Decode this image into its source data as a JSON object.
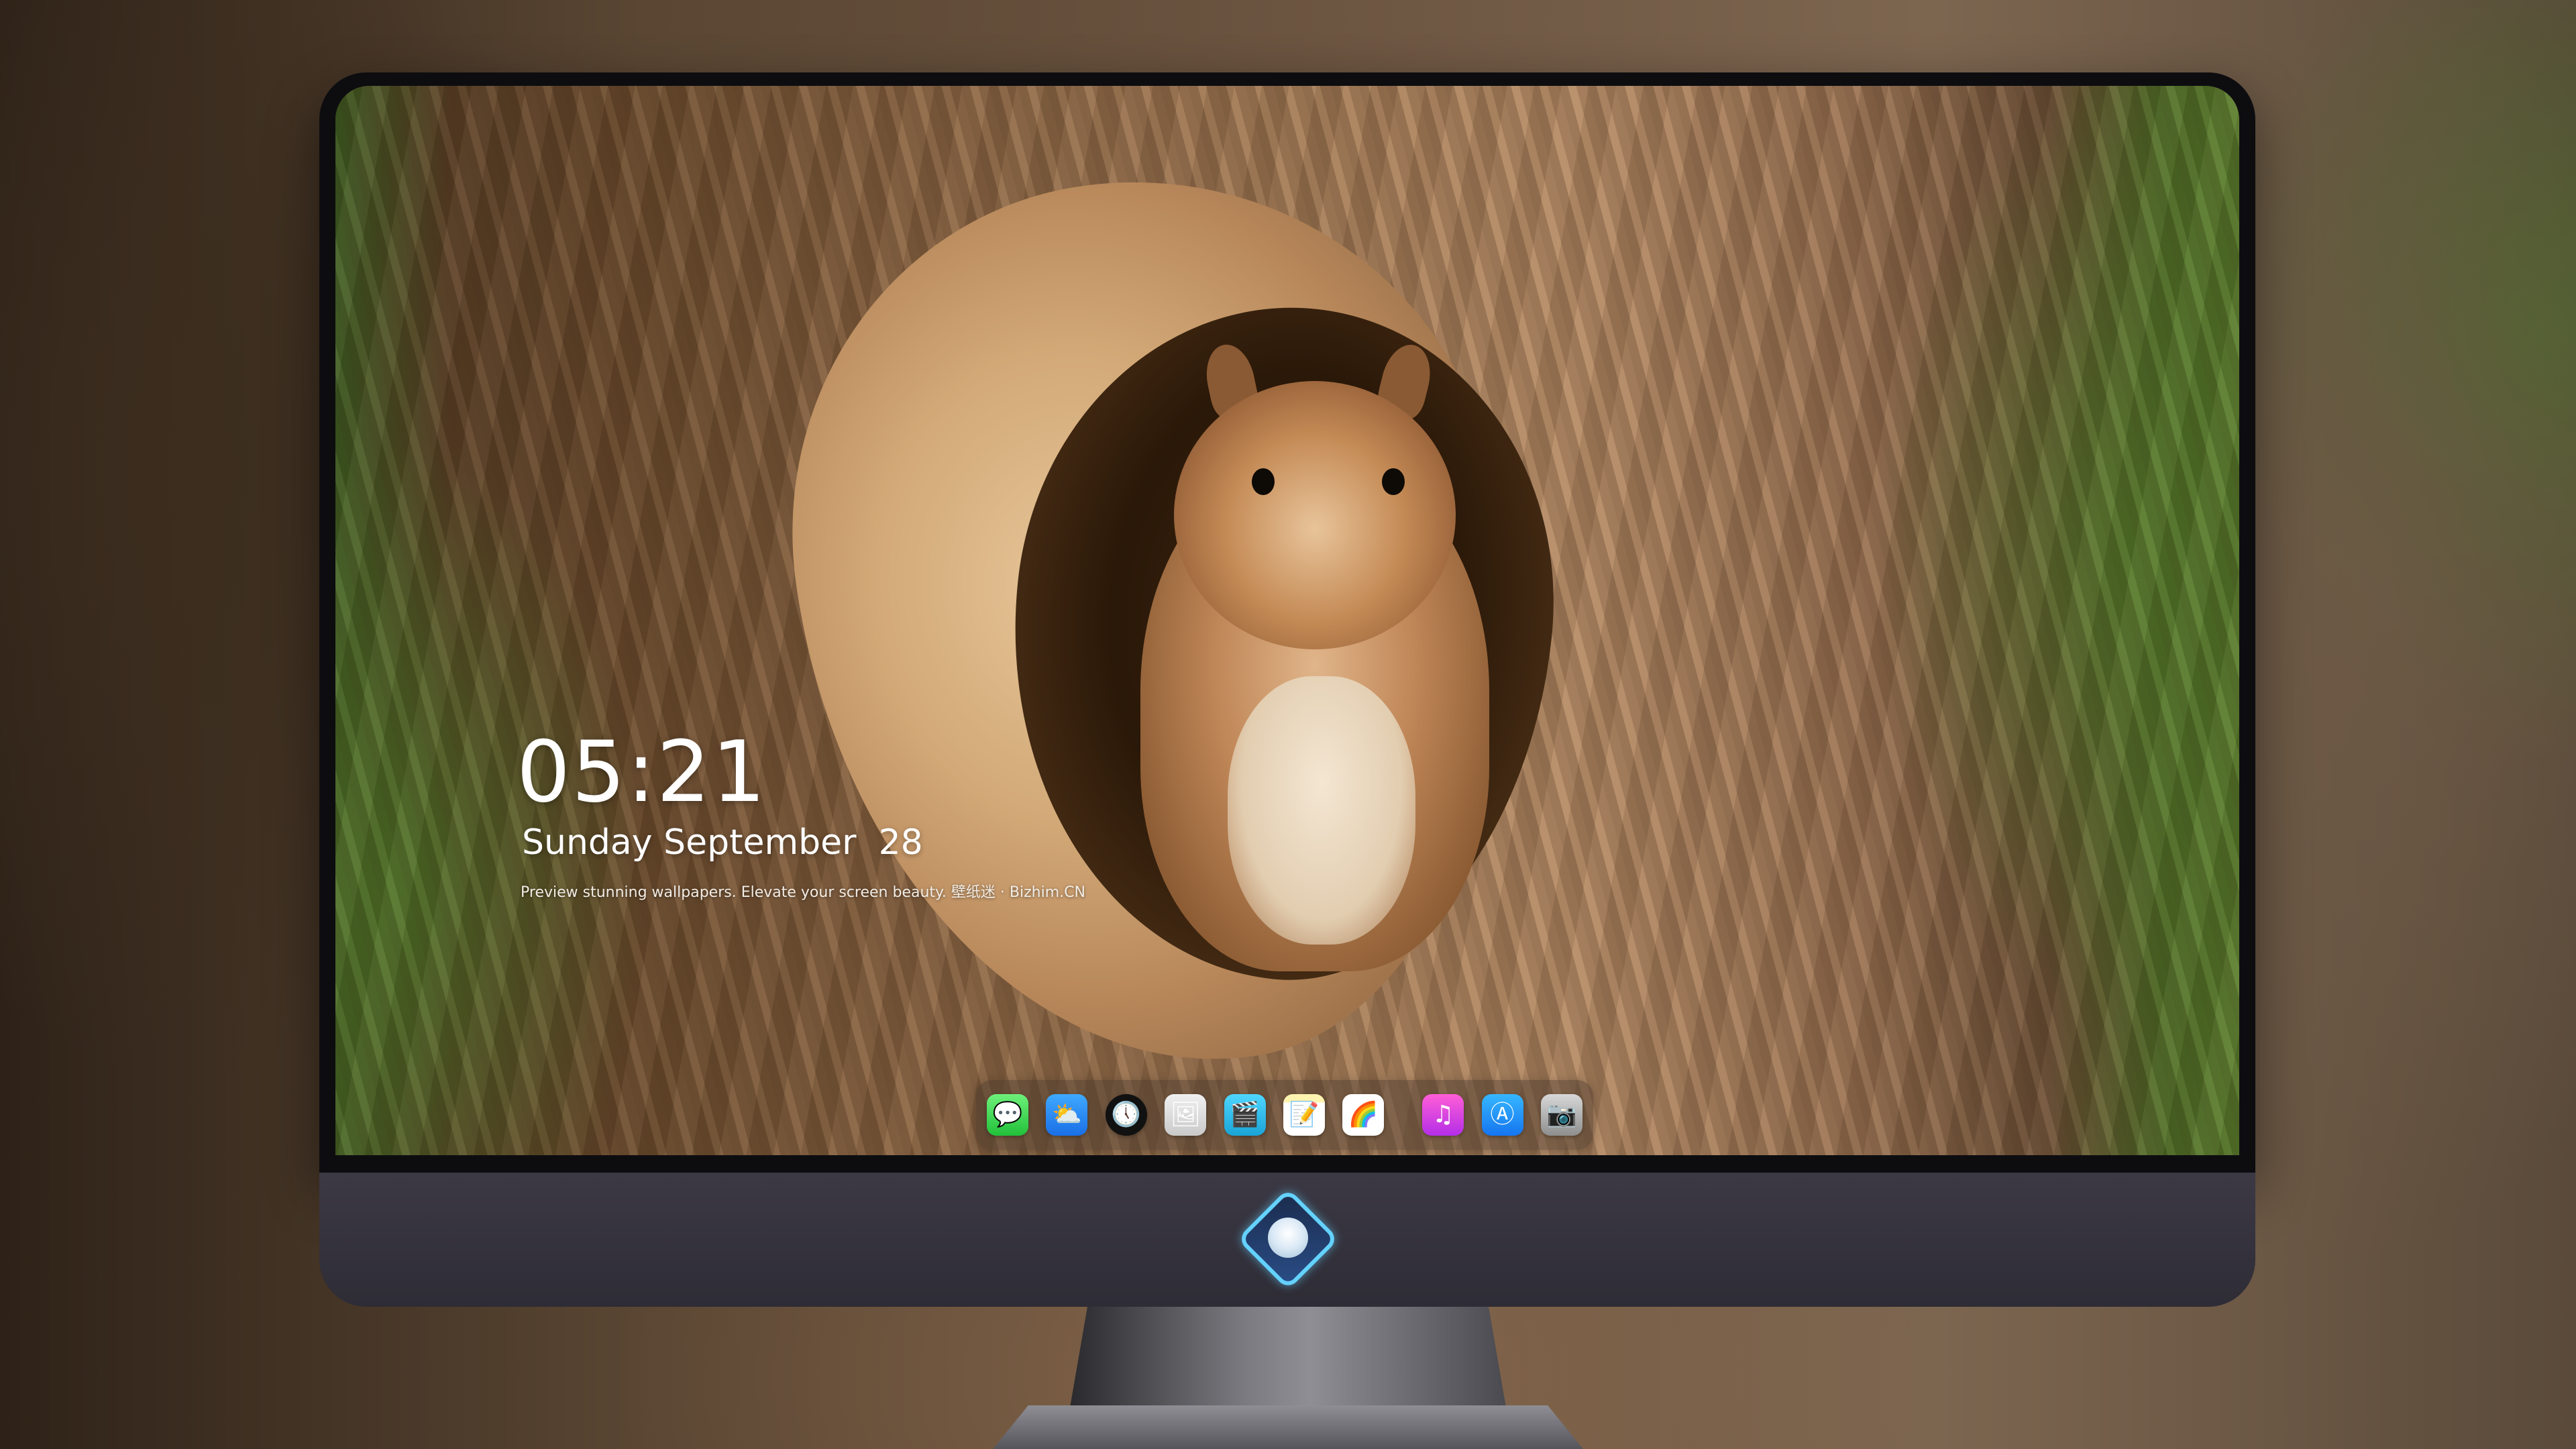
{
  "lock_screen": {
    "time": "05:21",
    "date": "Sunday September  28",
    "tagline": "Preview stunning wallpapers. Elevate your screen beauty. 壁纸迷 · Bizhim.CN"
  },
  "dock": {
    "apps": [
      {
        "name": "messages-icon",
        "glyph": "💬"
      },
      {
        "name": "weather-icon",
        "glyph": "⛅"
      },
      {
        "name": "clock-icon",
        "glyph": "🕔"
      },
      {
        "name": "preview-icon",
        "glyph": "🖼"
      },
      {
        "name": "videos-icon",
        "glyph": "🎬"
      },
      {
        "name": "notes-icon",
        "glyph": "📝"
      },
      {
        "name": "photos-icon",
        "glyph": "🌈"
      },
      {
        "name": "music-icon",
        "glyph": "♫"
      },
      {
        "name": "app-store-icon",
        "glyph": "Ⓐ"
      },
      {
        "name": "camera-icon",
        "glyph": "📷"
      }
    ]
  },
  "colors": {
    "bezel": "#0d0d10",
    "chin": "#3c3945",
    "dock_tint": "#463729",
    "text": "#ffffff"
  }
}
